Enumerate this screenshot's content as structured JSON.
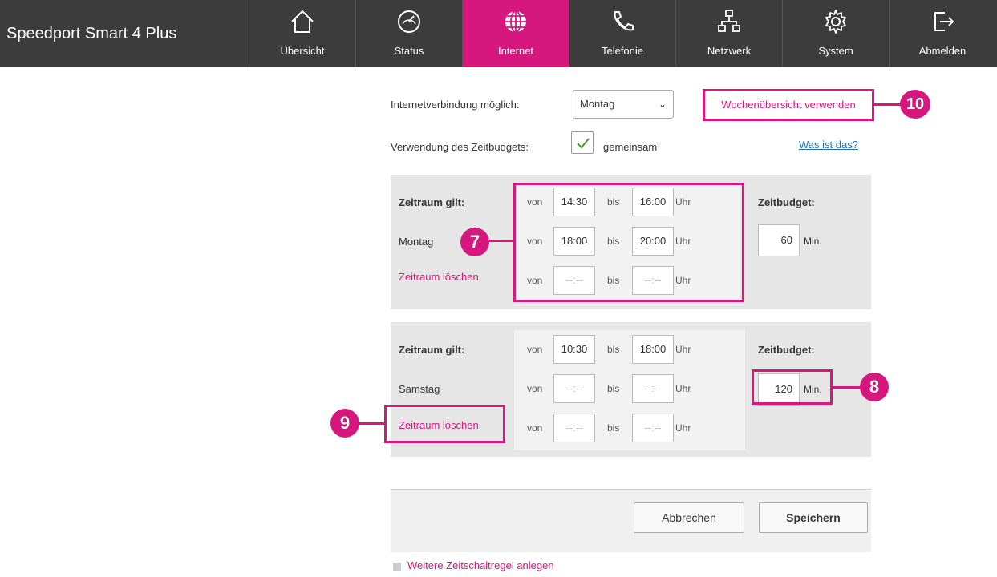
{
  "app": {
    "title": "Speedport Smart 4 Plus"
  },
  "nav": [
    {
      "label": "Übersicht",
      "icon": "home-icon"
    },
    {
      "label": "Status",
      "icon": "gauge-icon"
    },
    {
      "label": "Internet",
      "icon": "globe-icon",
      "active": true
    },
    {
      "label": "Telefonie",
      "icon": "phone-icon"
    },
    {
      "label": "Netzwerk",
      "icon": "network-icon"
    },
    {
      "label": "System",
      "icon": "gear-icon"
    },
    {
      "label": "Abmelden",
      "icon": "logout-icon"
    }
  ],
  "colors": {
    "accent": "#d6187e",
    "topbar": "#3c3c3c"
  },
  "form": {
    "connection_label": "Internetverbindung möglich:",
    "day_select": "Montag",
    "week_link": "Wochenübersicht verwenden",
    "budget_usage_label": "Verwendung des Zeitbudgets:",
    "budget_usage_checked": true,
    "budget_usage_value": "gemeinsam",
    "help_link": "Was ist das?"
  },
  "rules": [
    {
      "header": "Zeitraum gilt:",
      "day": "Montag",
      "delete": "Zeitraum löschen",
      "budget_label": "Zeitbudget:",
      "budget": "60",
      "budget_unit": "Min.",
      "periods": [
        {
          "from": "14:30",
          "to": "16:00"
        },
        {
          "from": "18:00",
          "to": "20:00"
        },
        {
          "from": "--:--",
          "to": "--:--"
        }
      ]
    },
    {
      "header": "Zeitraum gilt:",
      "day": "Samstag",
      "delete": "Zeitraum löschen",
      "budget_label": "Zeitbudget:",
      "budget": "120",
      "budget_unit": "Min.",
      "periods": [
        {
          "from": "10:30",
          "to": "18:00"
        },
        {
          "from": "--:--",
          "to": "--:--"
        },
        {
          "from": "--:--",
          "to": "--:--"
        }
      ]
    }
  ],
  "labels": {
    "from": "von",
    "to": "bis",
    "unit": "Uhr"
  },
  "callouts": [
    "7",
    "8",
    "9",
    "10"
  ],
  "buttons": {
    "cancel": "Abbrechen",
    "save": "Speichern"
  },
  "add_rule": "Weitere Zeitschaltregel anlegen"
}
